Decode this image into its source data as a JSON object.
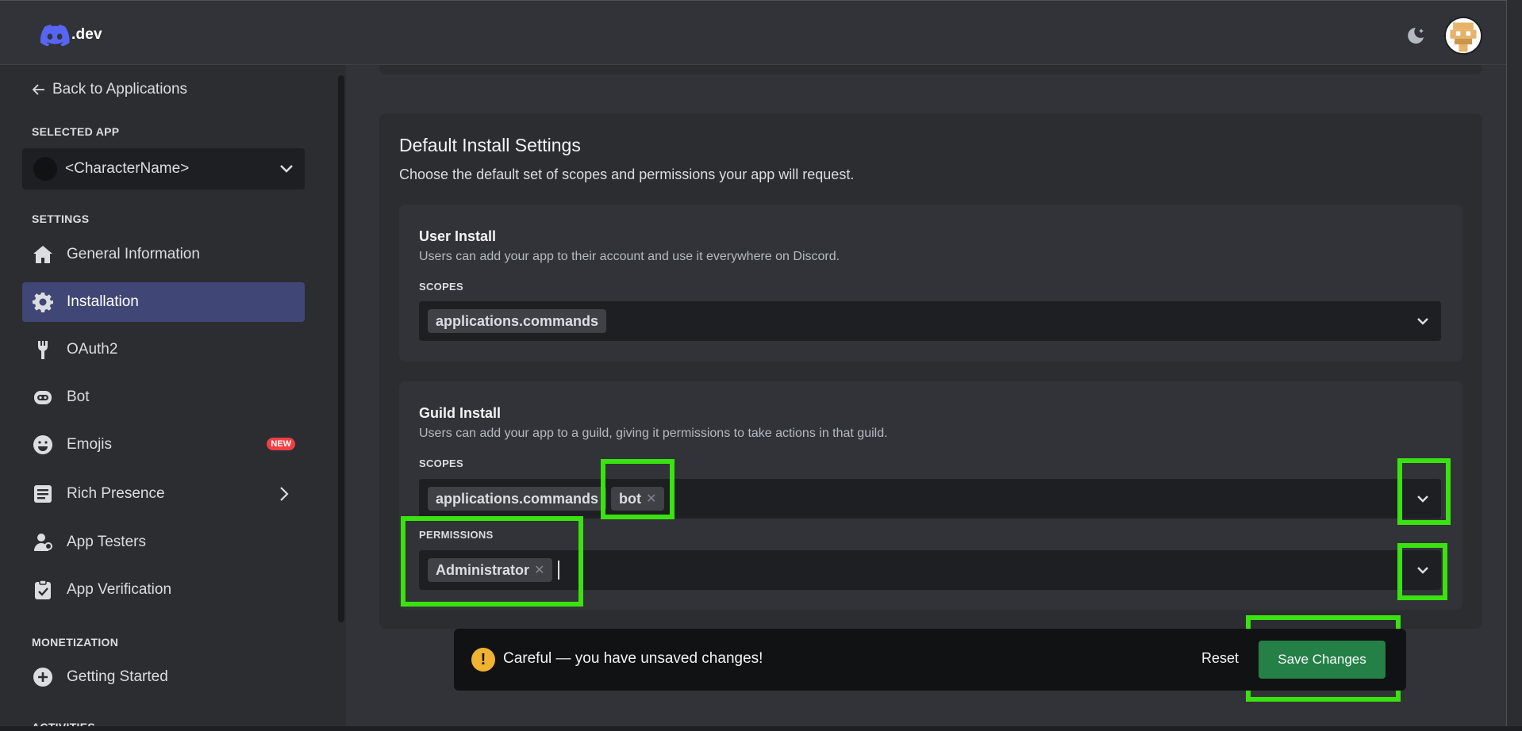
{
  "header": {
    "logo_text": ".dev"
  },
  "sidebar": {
    "back_label": "Back to Applications",
    "selected_app_label": "SELECTED APP",
    "selected_app_name": "<CharacterName>",
    "settings_label": "SETTINGS",
    "items": [
      {
        "label": "General Information",
        "icon": "home-icon"
      },
      {
        "label": "Installation",
        "icon": "gear-icon",
        "active": true
      },
      {
        "label": "OAuth2",
        "icon": "wrench-icon"
      },
      {
        "label": "Bot",
        "icon": "bot-icon"
      },
      {
        "label": "Emojis",
        "icon": "smile-icon",
        "badge": "NEW"
      },
      {
        "label": "Rich Presence",
        "icon": "document-icon"
      },
      {
        "label": "App Testers",
        "icon": "user-icon"
      },
      {
        "label": "App Verification",
        "icon": "clipboard-check-icon"
      }
    ],
    "monetization_label": "MONETIZATION",
    "monetization_items": [
      {
        "label": "Getting Started",
        "icon": "plus-circle-icon"
      }
    ],
    "activities_label": "ACTIVITIES"
  },
  "main": {
    "title": "Default Install Settings",
    "description": "Choose the default set of scopes and permissions your app will request.",
    "user_install": {
      "title": "User Install",
      "description": "Users can add your app to their account and use it everywhere on Discord.",
      "scopes_label": "SCOPES",
      "scopes": [
        "applications.commands"
      ]
    },
    "guild_install": {
      "title": "Guild Install",
      "description": "Users can add your app to a guild, giving it permissions to take actions in that guild.",
      "scopes_label": "SCOPES",
      "scopes": [
        "applications.commands",
        "bot"
      ],
      "permissions_label": "PERMISSIONS",
      "permissions": [
        "Administrator"
      ]
    }
  },
  "notice": {
    "warning_symbol": "!",
    "message": "Careful — you have unsaved changes!",
    "reset_label": "Reset",
    "save_label": "Save Changes"
  },
  "colors": {
    "accent": "#5865f2",
    "highlight": "#3ae20f",
    "save_green": "#248046",
    "badge_red": "#f23f43"
  }
}
